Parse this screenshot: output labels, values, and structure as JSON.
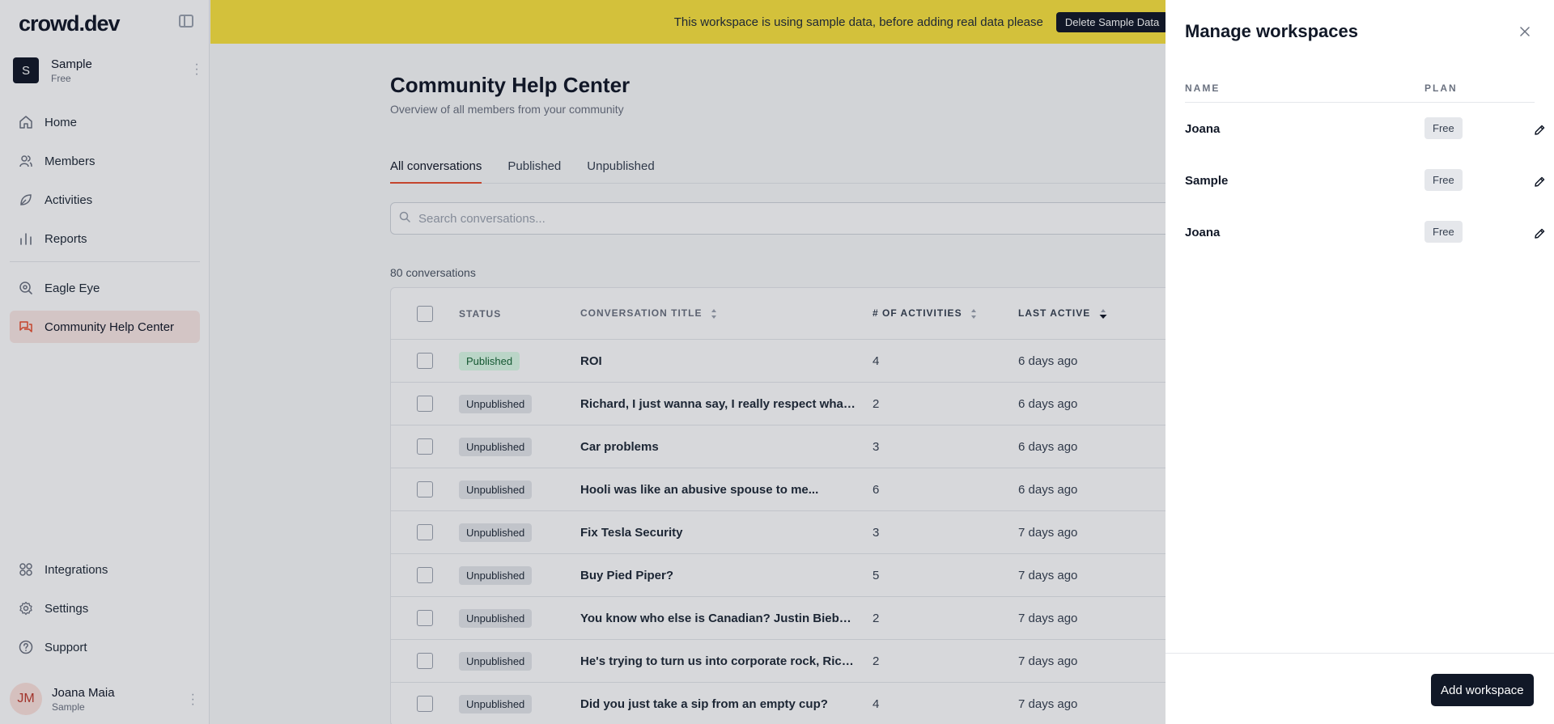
{
  "app": {
    "logo": "crowd.dev"
  },
  "sidebar": {
    "workspace": {
      "initial": "S",
      "name": "Sample",
      "plan": "Free"
    },
    "nav_top": [
      {
        "label": "Home",
        "icon": "home-icon"
      },
      {
        "label": "Members",
        "icon": "members-icon"
      },
      {
        "label": "Activities",
        "icon": "activities-icon"
      },
      {
        "label": "Reports",
        "icon": "reports-icon"
      }
    ],
    "nav_mid": [
      {
        "label": "Eagle Eye",
        "icon": "eagle-eye-icon"
      },
      {
        "label": "Community Help Center",
        "icon": "chat-icon",
        "active": true
      }
    ],
    "nav_bottom": [
      {
        "label": "Integrations",
        "icon": "integrations-icon"
      },
      {
        "label": "Settings",
        "icon": "gear-icon"
      },
      {
        "label": "Support",
        "icon": "help-icon"
      }
    ],
    "user": {
      "initials": "JM",
      "name": "Joana Maia",
      "workspace": "Sample"
    }
  },
  "banner": {
    "text": "This workspace is using sample data, before adding real data please",
    "button": "Delete Sample Data"
  },
  "main": {
    "title": "Community Help Center",
    "subtitle": "Overview of all members from your community",
    "tabs": [
      "All conversations",
      "Published",
      "Unpublished"
    ],
    "search_placeholder": "Search conversations...",
    "count": "80 conversations",
    "columns": {
      "status": "STATUS",
      "title": "CONVERSATION TITLE",
      "activities": "# OF ACTIVITIES",
      "last_active": "LAST ACTIVE"
    },
    "rows": [
      {
        "status": "Published",
        "title": "ROI",
        "activities": "4",
        "last_active": "6 days ago"
      },
      {
        "status": "Unpublished",
        "title": "Richard, I just wanna say, I really respect what you're doing",
        "activities": "2",
        "last_active": "6 days ago"
      },
      {
        "status": "Unpublished",
        "title": "Car problems",
        "activities": "3",
        "last_active": "6 days ago"
      },
      {
        "status": "Unpublished",
        "title": "Hooli was like an abusive spouse to me...",
        "activities": "6",
        "last_active": "6 days ago"
      },
      {
        "status": "Unpublished",
        "title": "Fix Tesla Security",
        "activities": "3",
        "last_active": "7 days ago"
      },
      {
        "status": "Unpublished",
        "title": "Buy Pied Piper?",
        "activities": "5",
        "last_active": "7 days ago"
      },
      {
        "status": "Unpublished",
        "title": "You know who else is Canadian? Justin Bieber. Think about it.",
        "activities": "2",
        "last_active": "7 days ago"
      },
      {
        "status": "Unpublished",
        "title": "He's trying to turn us into corporate rock, Richard",
        "activities": "2",
        "last_active": "7 days ago"
      },
      {
        "status": "Unpublished",
        "title": "Did you just take a sip from an empty cup?",
        "activities": "4",
        "last_active": "7 days ago"
      }
    ]
  },
  "drawer": {
    "title": "Manage workspaces",
    "col_name": "NAME",
    "col_plan": "PLAN",
    "workspaces": [
      {
        "name": "Joana",
        "plan": "Free"
      },
      {
        "name": "Sample",
        "plan": "Free"
      },
      {
        "name": "Joana",
        "plan": "Free"
      }
    ],
    "add_button": "Add workspace"
  },
  "colors": {
    "accent": "#e94f2e",
    "banner": "#fbe43f",
    "dark": "#111827"
  }
}
